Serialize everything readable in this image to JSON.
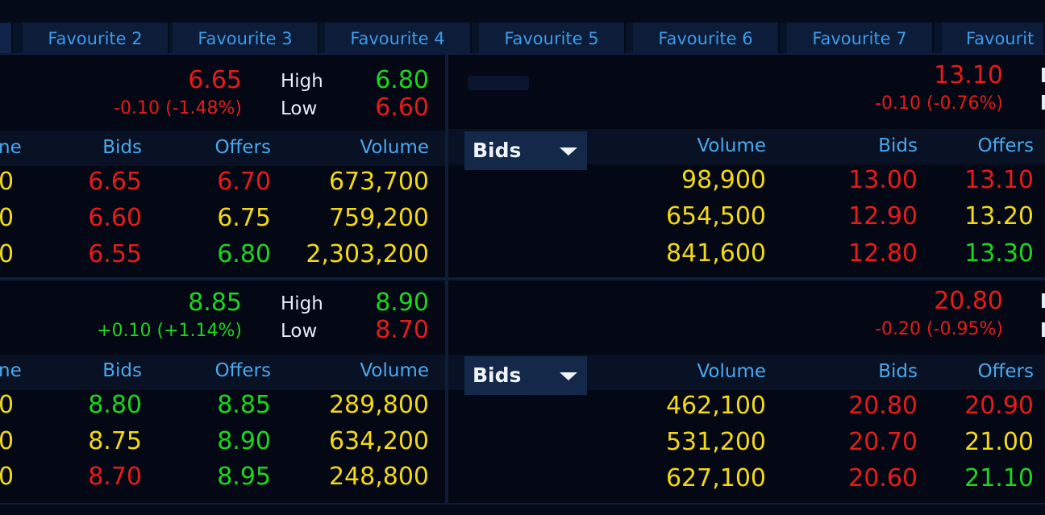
{
  "tabs": [
    "Favourite 2",
    "Favourite 3",
    "Favourite 4",
    "Favourite 5",
    "Favourite 6",
    "Favourite 7",
    "Favourit"
  ],
  "panels": {
    "tl": {
      "price": "6.65",
      "change": "-0.10 (-1.48%)",
      "high_label": "High",
      "high": "6.80",
      "low_label": "Low",
      "low": "6.60",
      "cut_header": "ne",
      "headers": [
        "Bids",
        "Offers",
        "Volume"
      ],
      "rows": [
        {
          "cut": "0",
          "bid": "6.65",
          "offer": "6.70",
          "volume": "673,700"
        },
        {
          "cut": "0",
          "bid": "6.60",
          "offer": "6.75",
          "volume": "759,200"
        },
        {
          "cut": "0",
          "bid": "6.55",
          "offer": "6.80",
          "volume": "2,303,200"
        }
      ]
    },
    "bl": {
      "price": "8.85",
      "change": "+0.10 (+1.14%)",
      "high_label": "High",
      "high": "8.90",
      "low_label": "Low",
      "low": "8.70",
      "cut_header": "ne",
      "headers": [
        "Bids",
        "Offers",
        "Volume"
      ],
      "rows": [
        {
          "cut": "0",
          "bid": "8.80",
          "offer": "8.85",
          "volume": "289,800"
        },
        {
          "cut": "0",
          "bid": "8.75",
          "offer": "8.90",
          "volume": "634,200"
        },
        {
          "cut": "0",
          "bid": "8.70",
          "offer": "8.95",
          "volume": "248,800"
        }
      ]
    },
    "tr": {
      "price": "13.10",
      "change": "-0.10 (-0.76%)",
      "dropdown": "Bids",
      "headers": [
        "Volume",
        "Bids",
        "Offers"
      ],
      "rows": [
        {
          "volume": "98,900",
          "bid": "13.00",
          "offer": "13.10"
        },
        {
          "volume": "654,500",
          "bid": "12.90",
          "offer": "13.20"
        },
        {
          "volume": "841,600",
          "bid": "12.80",
          "offer": "13.30"
        }
      ]
    },
    "br": {
      "price": "20.80",
      "change": "-0.20 (-0.95%)",
      "dropdown": "Bids",
      "headers": [
        "Volume",
        "Bids",
        "Offers"
      ],
      "rows": [
        {
          "volume": "462,100",
          "bid": "20.80",
          "offer": "20.90"
        },
        {
          "volume": "531,200",
          "bid": "20.70",
          "offer": "21.00"
        },
        {
          "volume": "627,100",
          "bid": "20.60",
          "offer": "21.10"
        }
      ]
    }
  },
  "colors": {
    "background": "#040a18",
    "header_text": "#4aa8ee",
    "down": "#e81a1a",
    "up": "#1ed51e",
    "neutral": "#f3d814"
  }
}
